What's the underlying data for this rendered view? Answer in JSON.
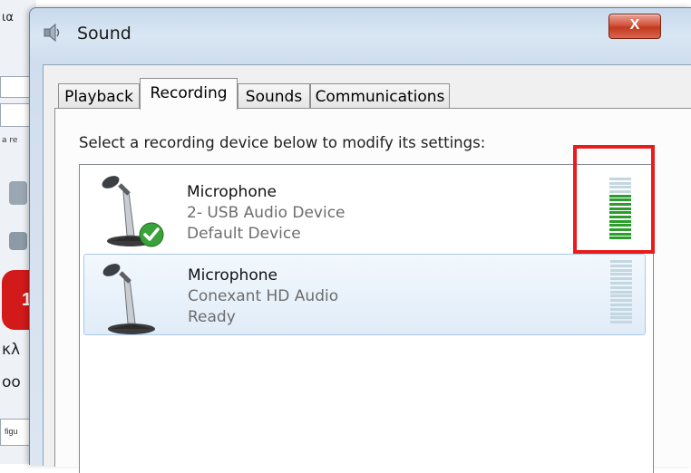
{
  "background_window": {
    "fragments": [
      "ια",
      "a re",
      "1",
      "κλ",
      "οο",
      "figu"
    ]
  },
  "dialog": {
    "title": "Sound",
    "close_label": "X",
    "tabs": [
      {
        "label": "Playback",
        "active": false
      },
      {
        "label": "Recording",
        "active": true
      },
      {
        "label": "Sounds",
        "active": false
      },
      {
        "label": "Communications",
        "active": false
      }
    ],
    "instruction": "Select a recording device below to modify its settings:",
    "devices": [
      {
        "name": "Microphone",
        "description": "2- USB Audio Device",
        "status": "Default Device",
        "is_default": true,
        "selected": false,
        "level_segments_active": 11,
        "level_segments_total": 15
      },
      {
        "name": "Microphone",
        "description": "Conexant HD Audio",
        "status": "Ready",
        "is_default": false,
        "selected": true,
        "level_segments_active": 0,
        "level_segments_total": 15
      }
    ]
  },
  "annotation": {
    "highlight_color": "#e81c1c"
  },
  "colors": {
    "meter_active": "#2a9d2a",
    "meter_inactive": "#c4d7e0",
    "selection": "#a9c9ea"
  }
}
